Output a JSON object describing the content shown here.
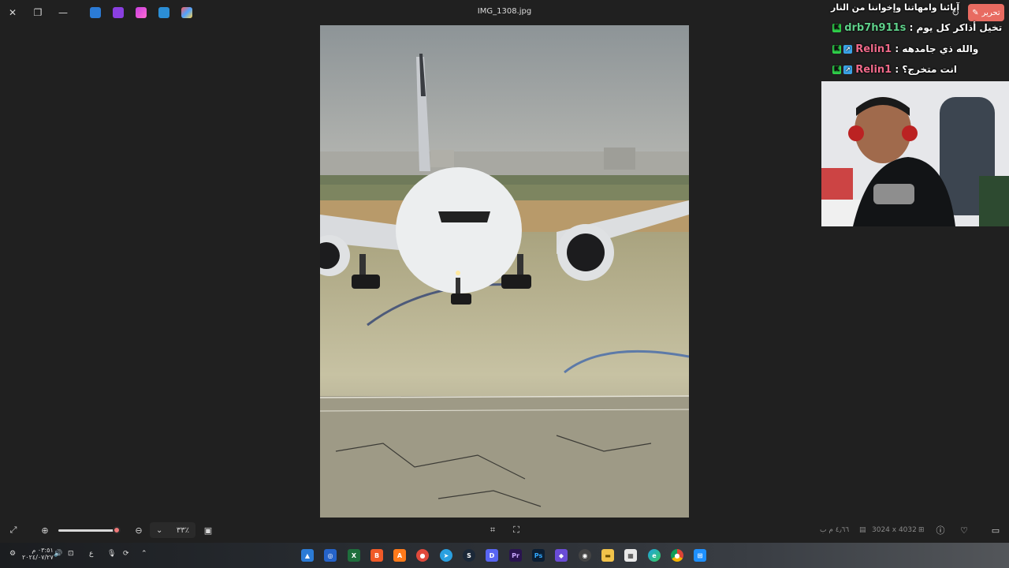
{
  "window": {
    "title": "IMG_1308.jpg",
    "edit_button": "تحرير"
  },
  "chat": {
    "header": "آبائنا وامهاتنا وإخواننا من النار",
    "messages": [
      {
        "user": "drb7h911s",
        "user_color": "#5fd08a",
        "text": "تخيل أذاكر كل يوم :"
      },
      {
        "user": "Relin1",
        "user_color": "#f06a8a",
        "text": "والله ذي جامدهه :"
      },
      {
        "user": "Relin1",
        "user_color": "#f06a8a",
        "text": "انت متخرج؟ :"
      }
    ]
  },
  "bottom_toolbar": {
    "zoom_level": "٣٣٪",
    "zoom_slider_fraction": 0.95,
    "file_size": "٤٫٦٦ م ب",
    "dimensions": "3024 x 4032"
  },
  "taskbar": {
    "time": "٠٣:٥١ م",
    "date": "٢٠٢٤/٠٧/٢٧",
    "lang": "ع"
  }
}
